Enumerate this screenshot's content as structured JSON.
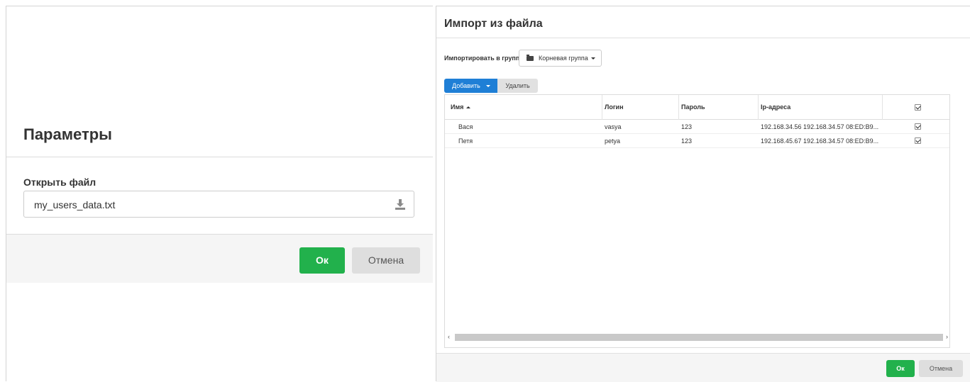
{
  "left_dialog": {
    "title": "Параметры",
    "file_label": "Открыть файл",
    "file_value": "my_users_data.txt",
    "ok_label": "Ок",
    "cancel_label": "Отмена"
  },
  "right_dialog": {
    "title": "Импорт из файла",
    "group_label": "Импортировать в группу",
    "group_selected": "Корневая группа",
    "add_label": "Добавить",
    "delete_label": "Удалить",
    "columns": [
      "Имя",
      "Логин",
      "Пароль",
      "Ip-адреса"
    ],
    "rows": [
      {
        "name": "Вася",
        "login": "vasya",
        "password": "123",
        "ips": "192.168.34.56 192.168.34.57 08:ED:B9...",
        "checked": true
      },
      {
        "name": "Петя",
        "login": "petya",
        "password": "123",
        "ips": "192.168.45.67 192.168.34.57 08:ED:B9...",
        "checked": true
      }
    ],
    "scroll_left": "‹",
    "scroll_right": "›",
    "ok_label": "Ок",
    "cancel_label": "Отмена"
  },
  "colors": {
    "ok_green": "#22b14c",
    "add_blue": "#1f7fd6"
  },
  "icons": {
    "download": "download-icon",
    "folder": "folder-icon",
    "checkbox": "checkbox-checked-icon"
  }
}
